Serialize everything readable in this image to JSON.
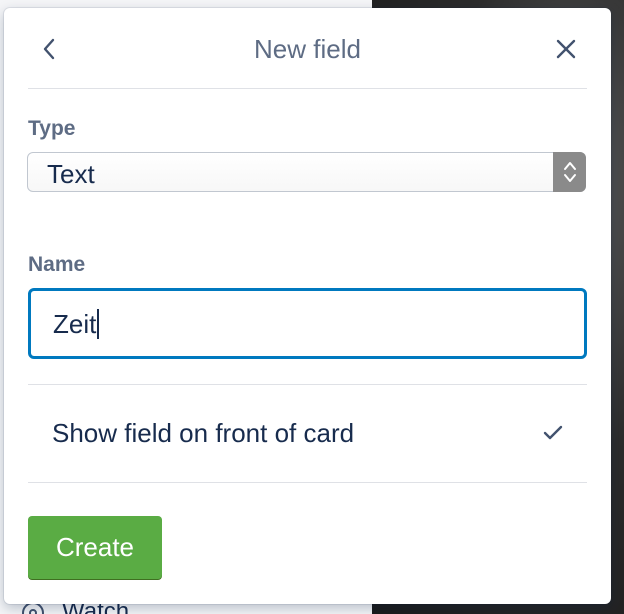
{
  "header": {
    "title": "New field",
    "back_icon": "chevron-left-icon",
    "close_icon": "close-icon"
  },
  "type_field": {
    "label": "Type",
    "selected": "Text",
    "icon": "select-arrows-icon"
  },
  "name_field": {
    "label": "Name",
    "value": "Zeit"
  },
  "front_toggle": {
    "label": "Show field on front of card",
    "checked": true,
    "icon": "check-icon"
  },
  "create_button": {
    "label": "Create"
  },
  "background": {
    "watch_label": "Watch",
    "watch_icon": "eye-icon"
  },
  "colors": {
    "primary_button": "#5aac44",
    "focus_border": "#0079bf",
    "title_text": "#5e6c84",
    "body_text": "#172b4d"
  }
}
